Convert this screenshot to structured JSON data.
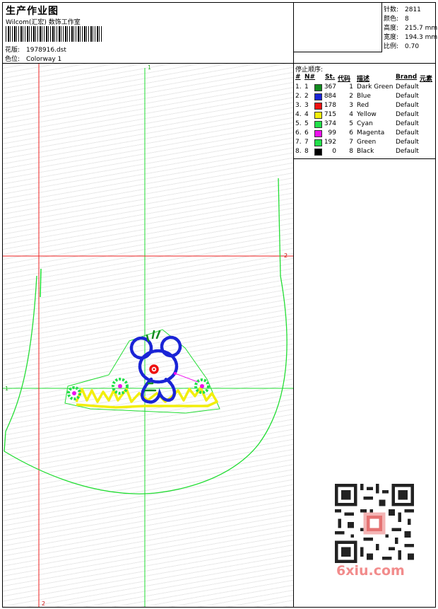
{
  "header": {
    "title": "生产作业图",
    "company": "Wilcom(汇宏) 数饰工作室",
    "design_label": "花版:",
    "design_value": "1978916.dst",
    "colorway_label": "色位:",
    "colorway_value": "Colorway 1"
  },
  "stats": {
    "stitches_label": "针数:",
    "stitches_value": "2811",
    "colors_label": "颜色:",
    "colors_value": "8",
    "height_label": "高度:",
    "height_value": "215.7 mm",
    "width_label": "宽度:",
    "width_value": "194.3 mm",
    "scale_label": "比例:",
    "scale_value": "0.70"
  },
  "canvas": {
    "markers": {
      "top_green": "1",
      "left_green": "1",
      "right_red": "2",
      "bottom_red": "2"
    }
  },
  "threads": {
    "title": "停止顺序:",
    "headers": {
      "idx": "#",
      "no": "N#",
      "stitches": "St.",
      "code": "代码",
      "desc": "描述",
      "brand": "Brand",
      "element": "元素"
    },
    "rows": [
      {
        "idx": "1.",
        "no": "1",
        "color": "#118a1f",
        "stitches": "367",
        "code": "1",
        "desc": "Dark Green",
        "brand": "Default"
      },
      {
        "idx": "2.",
        "no": "2",
        "color": "#1a24d6",
        "stitches": "884",
        "code": "2",
        "desc": "Blue",
        "brand": "Default"
      },
      {
        "idx": "3.",
        "no": "3",
        "color": "#ee1111",
        "stitches": "178",
        "code": "3",
        "desc": "Red",
        "brand": "Default"
      },
      {
        "idx": "4.",
        "no": "4",
        "color": "#f2ee0c",
        "stitches": "715",
        "code": "4",
        "desc": "Yellow",
        "brand": "Default"
      },
      {
        "idx": "5.",
        "no": "5",
        "color": "#22e04a",
        "stitches": "374",
        "code": "5",
        "desc": "Cyan",
        "brand": "Default"
      },
      {
        "idx": "6.",
        "no": "6",
        "color": "#ee11ee",
        "stitches": "99",
        "code": "6",
        "desc": "Magenta",
        "brand": "Default"
      },
      {
        "idx": "7.",
        "no": "7",
        "color": "#22e04a",
        "stitches": "192",
        "code": "7",
        "desc": "Green",
        "brand": "Default"
      },
      {
        "idx": "8.",
        "no": "8",
        "color": "#000000",
        "stitches": "0",
        "code": "8",
        "desc": "Black",
        "brand": "Default"
      }
    ]
  },
  "watermark": {
    "text": "6xiu.com",
    "color": "#f28c8c"
  },
  "colors": {
    "guide_green": "#22dd33",
    "guide_red": "#ee2222",
    "outline_green": "#22dd33"
  }
}
